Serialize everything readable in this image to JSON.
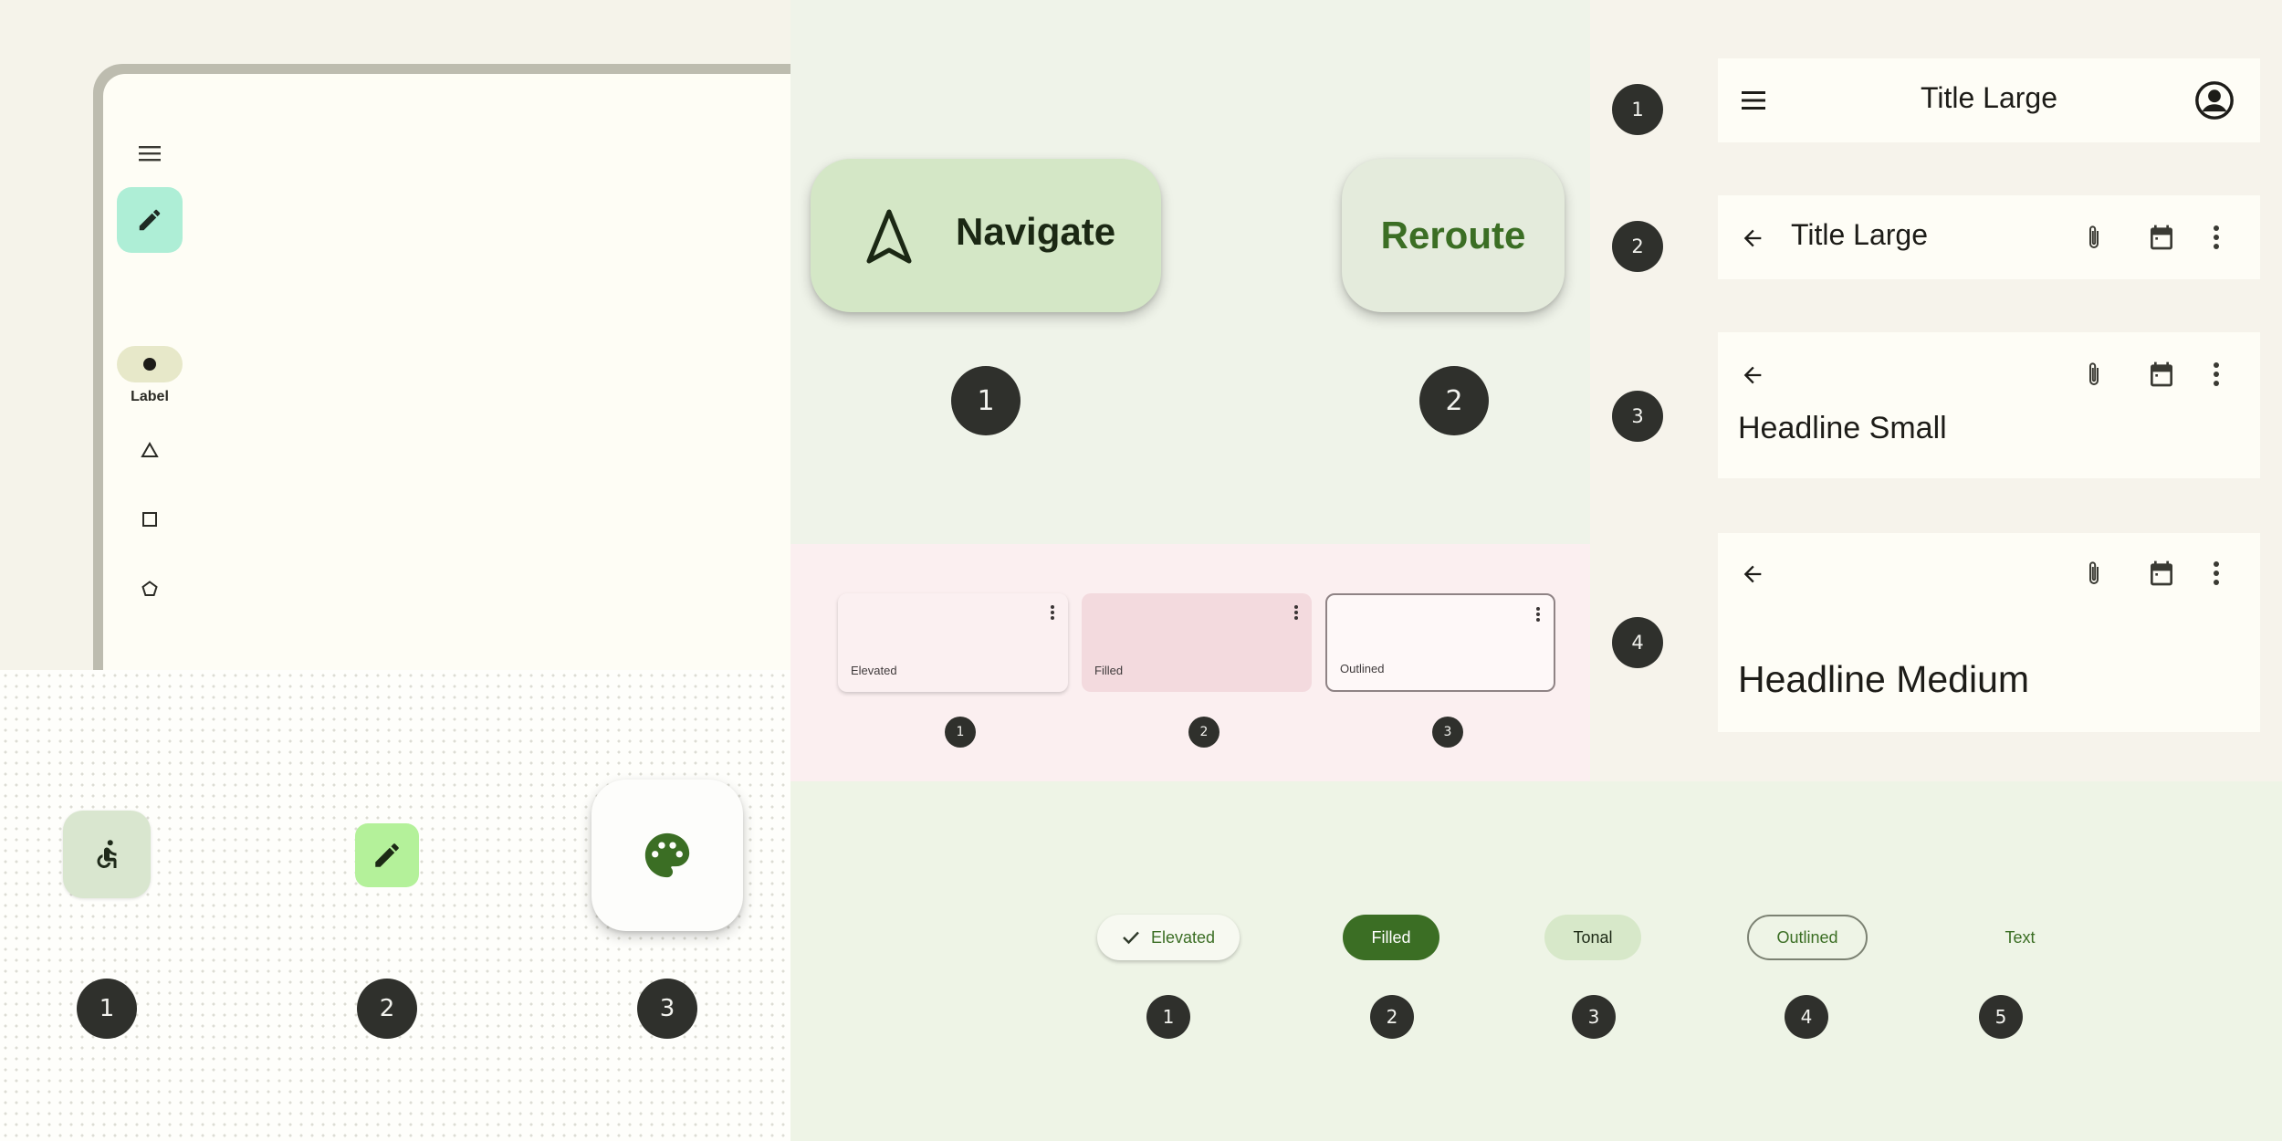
{
  "navigation_rail": {
    "menu_icon": "menu-icon",
    "fab_icon": "pencil-icon",
    "active_item_icon": "circle-icon",
    "active_item_label": "Label",
    "items": [
      {
        "icon": "triangle-icon"
      },
      {
        "icon": "square-icon"
      },
      {
        "icon": "pentagon-icon"
      }
    ]
  },
  "fab_sizes": {
    "fabs": [
      {
        "icon": "accessibility-icon",
        "badge": "1"
      },
      {
        "icon": "pencil-icon",
        "badge": "2"
      },
      {
        "icon": "palette-icon",
        "badge": "3"
      }
    ]
  },
  "extended_fabs": {
    "items": [
      {
        "label": "Navigate",
        "icon": "navigation-arrow-icon",
        "badge": "1"
      },
      {
        "label": "Reroute",
        "badge": "2"
      }
    ]
  },
  "cards": {
    "items": [
      {
        "label": "Elevated",
        "badge": "1"
      },
      {
        "label": "Filled",
        "badge": "2"
      },
      {
        "label": "Outlined",
        "badge": "3"
      }
    ]
  },
  "chips": {
    "items": [
      {
        "label": "Elevated",
        "icon": "check-icon",
        "badge": "1"
      },
      {
        "label": "Filled",
        "badge": "2"
      },
      {
        "label": "Tonal",
        "badge": "3"
      },
      {
        "label": "Outlined",
        "badge": "4"
      },
      {
        "label": "Text",
        "badge": "5"
      }
    ]
  },
  "top_app_bars": {
    "bars": [
      {
        "badge": "1",
        "title": "Title Large",
        "nav_icon": "menu-icon",
        "actions": [
          "account-circle-icon"
        ]
      },
      {
        "badge": "2",
        "title": "Title Large",
        "nav_icon": "arrow-back-icon",
        "actions": [
          "attachment-icon",
          "calendar-icon",
          "more-vert-icon"
        ]
      },
      {
        "badge": "3",
        "title": "Headline Small",
        "nav_icon": "arrow-back-icon",
        "actions": [
          "attachment-icon",
          "calendar-icon",
          "more-vert-icon"
        ]
      },
      {
        "badge": "4",
        "title": "Headline Medium",
        "nav_icon": "arrow-back-icon",
        "actions": [
          "attachment-icon",
          "calendar-icon",
          "more-vert-icon"
        ]
      }
    ]
  },
  "colors": {
    "primary_green": "#3b6e24",
    "badge_dark": "#2f302c",
    "rail_fab": "#aeeed6",
    "tonal_container": "#dbe7cd",
    "card_pink": "#f3dade"
  }
}
